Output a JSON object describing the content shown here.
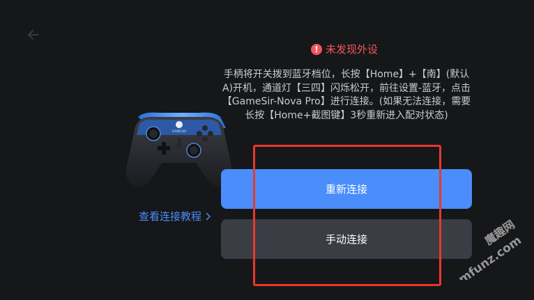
{
  "alert": {
    "icon": "exclamation-icon",
    "text": "未发现外设",
    "color": "#f0575e"
  },
  "instructions": {
    "text": "手柄将开关拨到蓝牙档位，长按【Home】+【南】(默认A)开机，通道灯【三四】闪烁松开，前往设置-蓝牙，点击【GameSir-Nova Pro】进行连接。(如果无法连接，需要长按【Home+截图键】3秒重新进入配对状态)"
  },
  "controller": {
    "brand_text": "GAMESIR"
  },
  "tutorial_link": {
    "label": "查看连接教程",
    "icon": "chevron-right-icon",
    "color": "#4a8eff"
  },
  "buttons": {
    "reconnect_label": "重新连接",
    "manual_label": "手动连接"
  },
  "watermark": {
    "text": "魔趣网",
    "domain": "mfunz.com"
  },
  "colors": {
    "background": "#161719",
    "primary": "#4a8dfb",
    "secondary": "#3b3d45",
    "highlight": "#e8392b"
  }
}
